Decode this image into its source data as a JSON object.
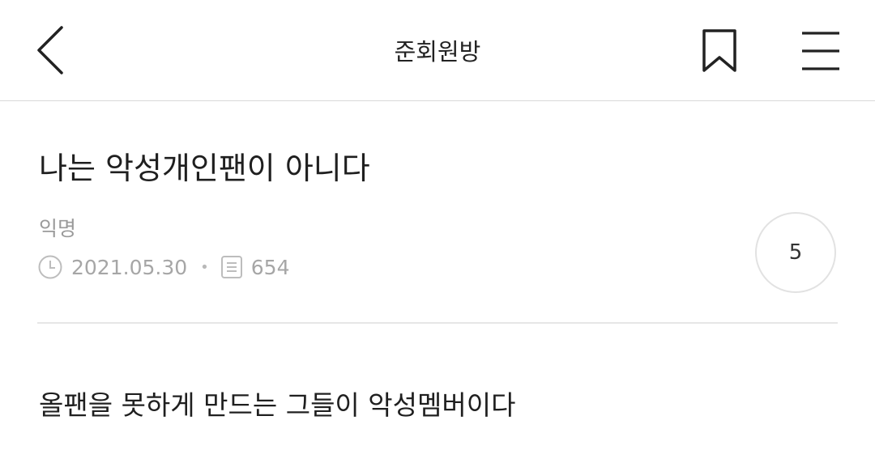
{
  "header": {
    "board_title": "준회원방",
    "back_icon": "chevron-left-icon",
    "bookmark_icon": "bookmark-icon",
    "menu_icon": "hamburger-menu-icon"
  },
  "post": {
    "title": "나는 악성개인팬이 아니다",
    "author": "익명",
    "date": "2021.05.30",
    "views": "654",
    "comment_count": "5",
    "body": "올팬을 못하게 만드는 그들이 악성멤버이다"
  },
  "colors": {
    "text": "#222222",
    "meta": "#a6a6a6",
    "divider": "#e6e6e6"
  }
}
